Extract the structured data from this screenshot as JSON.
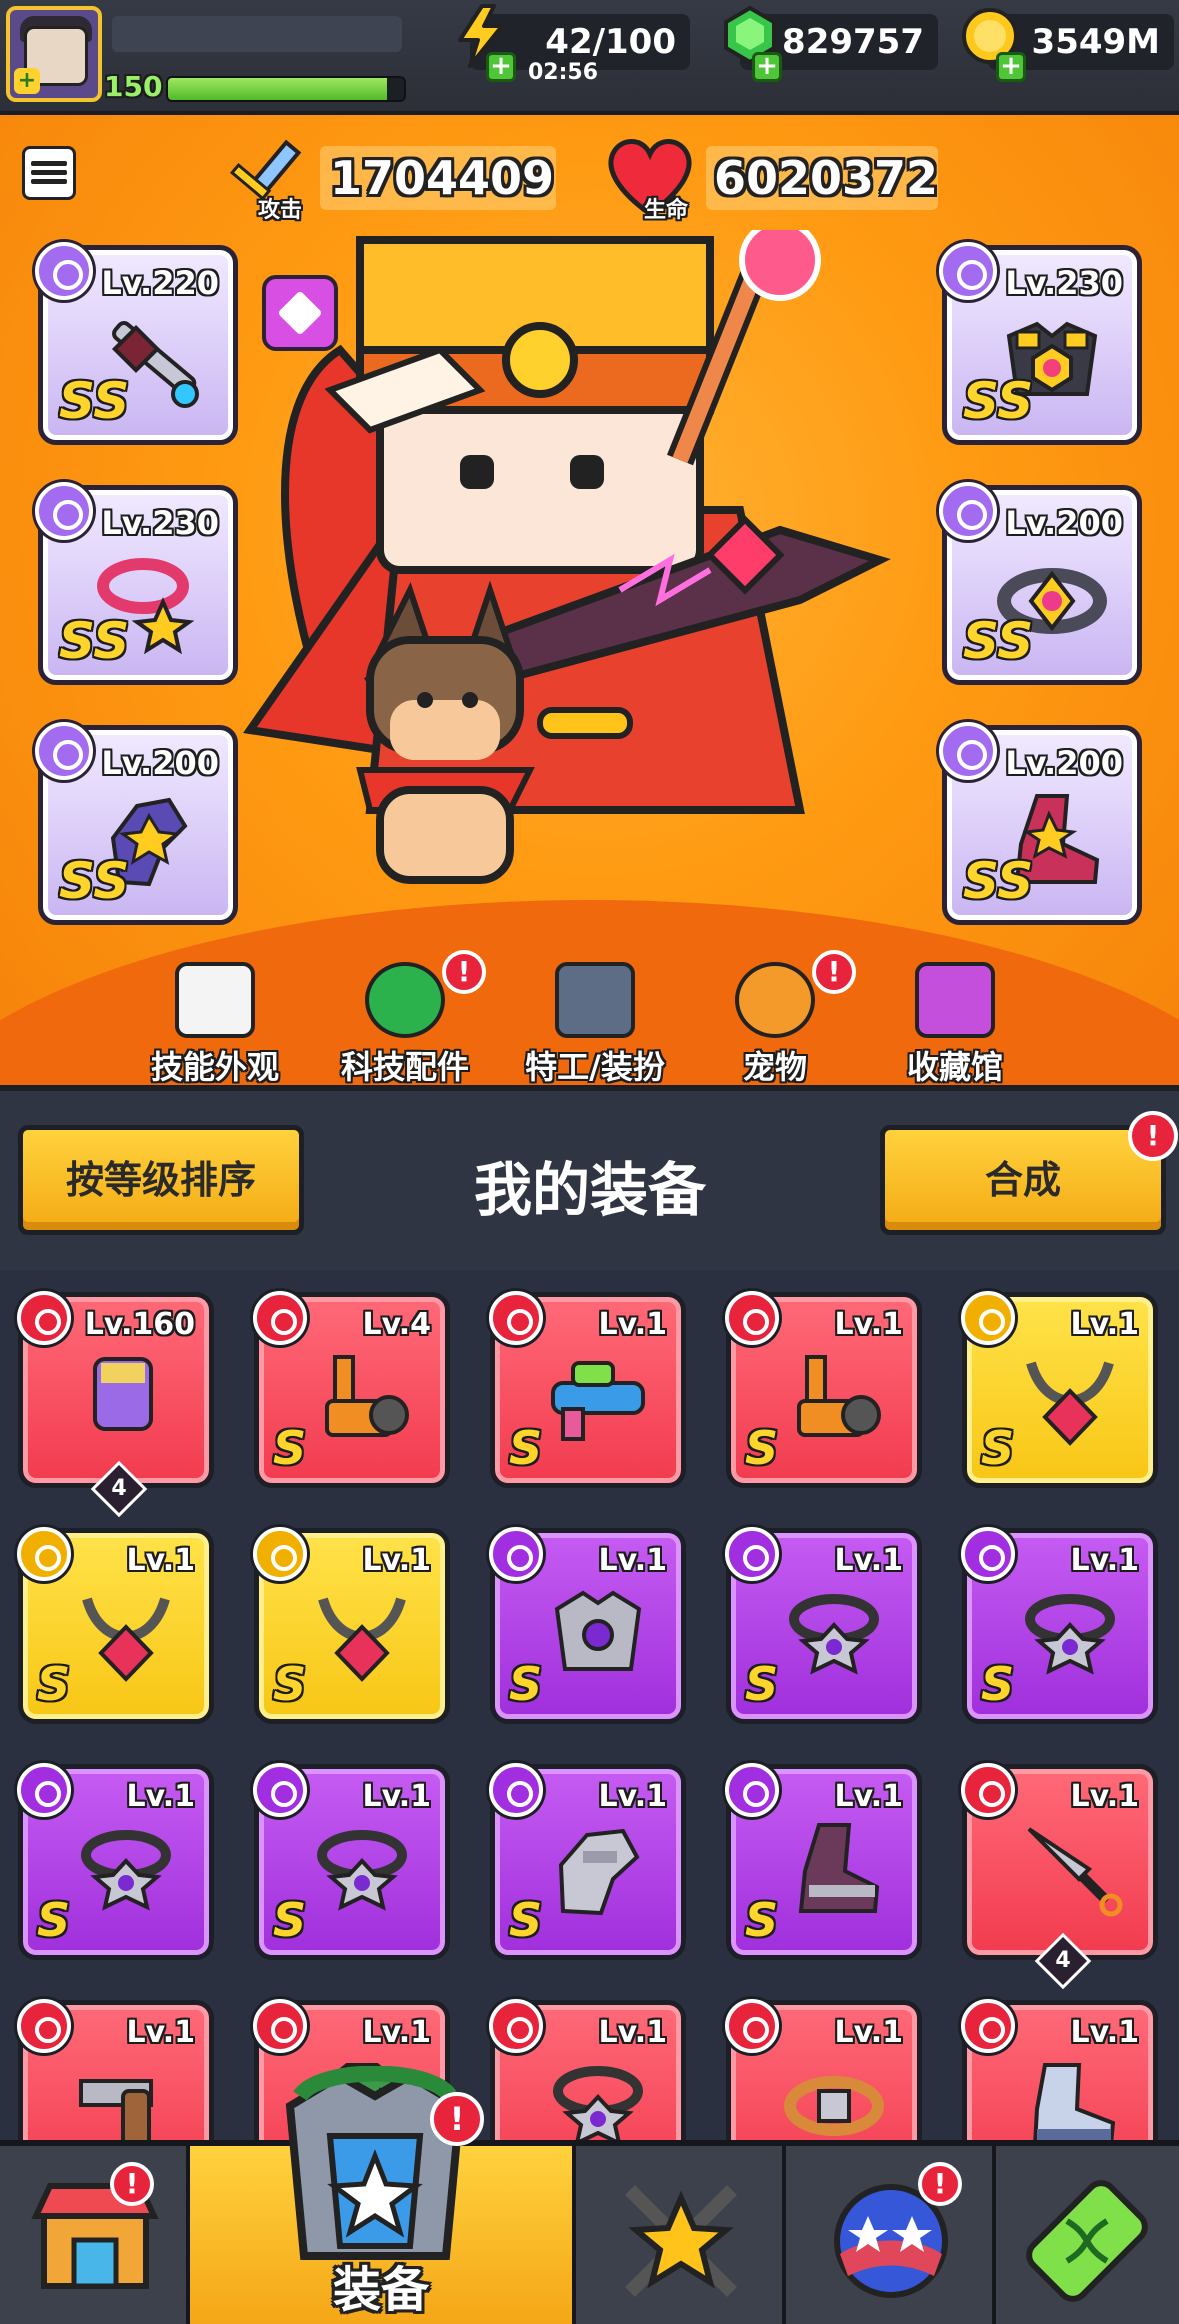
{
  "player": {
    "level": "150",
    "xp_fraction": 0.93
  },
  "resources": {
    "energy": "42/100",
    "energy_timer": "02:56",
    "gems": "829757",
    "coins": "3549M"
  },
  "stats": {
    "attack_label": "攻击",
    "attack_value": "1704409",
    "hp_label": "生命",
    "hp_value": "6020372"
  },
  "equipped": [
    {
      "slot": "weapon",
      "level": "Lv.220",
      "rank": "SS",
      "icon": "sword-staff-icon"
    },
    {
      "slot": "armor",
      "level": "Lv.230",
      "rank": "SS",
      "icon": "armor-icon"
    },
    {
      "slot": "necklace",
      "level": "Lv.230",
      "rank": "SS",
      "icon": "necklace-icon"
    },
    {
      "slot": "belt",
      "level": "Lv.200",
      "rank": "SS",
      "icon": "belt-icon"
    },
    {
      "slot": "gloves",
      "level": "Lv.200",
      "rank": "SS",
      "icon": "glove-icon"
    },
    {
      "slot": "boots",
      "level": "Lv.200",
      "rank": "SS",
      "icon": "boot-icon"
    }
  ],
  "sub_menu": [
    {
      "label": "技能外观",
      "icon": "soccer-ball-hat-icon",
      "alert": false
    },
    {
      "label": "科技配件",
      "icon": "hex-gear-icon",
      "alert": true
    },
    {
      "label": "特工/装扮",
      "icon": "agent-icon",
      "alert": false
    },
    {
      "label": "宠物",
      "icon": "shiba-pet-icon",
      "alert": true
    },
    {
      "label": "收藏馆",
      "icon": "collection-chest-icon",
      "alert": false
    }
  ],
  "equip_header": {
    "sort_label": "按等级排序",
    "title": "我的装备",
    "merge_label": "合成",
    "merge_alert": "!"
  },
  "inventory": [
    {
      "color": "red",
      "level": "Lv.160",
      "rank": "",
      "count": "4",
      "icon": "gauntlet-icon"
    },
    {
      "color": "red",
      "level": "Lv.4",
      "rank": "S",
      "count": "",
      "icon": "wheel-cannon-icon"
    },
    {
      "color": "red",
      "level": "Lv.1",
      "rank": "S",
      "count": "",
      "icon": "water-gun-icon"
    },
    {
      "color": "red",
      "level": "Lv.1",
      "rank": "S",
      "count": "",
      "icon": "wheel-cannon-icon"
    },
    {
      "color": "yellow",
      "level": "Lv.1",
      "rank": "S",
      "count": "",
      "icon": "chain-necklace-icon"
    },
    {
      "color": "yellow",
      "level": "Lv.1",
      "rank": "S",
      "count": "",
      "icon": "chain-necklace-icon"
    },
    {
      "color": "yellow",
      "level": "Lv.1",
      "rank": "S",
      "count": "",
      "icon": "chain-necklace-icon"
    },
    {
      "color": "purple",
      "level": "Lv.1",
      "rank": "S",
      "count": "",
      "icon": "spiked-armor-icon"
    },
    {
      "color": "purple",
      "level": "Lv.1",
      "rank": "S",
      "count": "",
      "icon": "spiked-collar-icon"
    },
    {
      "color": "purple",
      "level": "Lv.1",
      "rank": "S",
      "count": "",
      "icon": "spiked-collar-icon"
    },
    {
      "color": "purple",
      "level": "Lv.1",
      "rank": "S",
      "count": "",
      "icon": "spiked-collar-icon"
    },
    {
      "color": "purple",
      "level": "Lv.1",
      "rank": "S",
      "count": "",
      "icon": "spiked-collar-icon"
    },
    {
      "color": "purple",
      "level": "Lv.1",
      "rank": "S",
      "count": "",
      "icon": "armored-glove-icon"
    },
    {
      "color": "purple",
      "level": "Lv.1",
      "rank": "S",
      "count": "",
      "icon": "armored-boot-icon"
    },
    {
      "color": "red",
      "level": "Lv.1",
      "rank": "",
      "count": "4",
      "icon": "kunai-icon"
    },
    {
      "color": "red",
      "level": "Lv.1",
      "rank": "",
      "count": "",
      "icon": "revolver-icon"
    },
    {
      "color": "red",
      "level": "Lv.1",
      "rank": "",
      "count": "",
      "icon": "shirt-icon"
    },
    {
      "color": "red",
      "level": "Lv.1",
      "rank": "",
      "count": "",
      "icon": "spiked-collar-icon"
    },
    {
      "color": "red",
      "level": "Lv.1",
      "rank": "",
      "count": "",
      "icon": "belt-icon"
    },
    {
      "color": "red",
      "level": "Lv.1",
      "rank": "",
      "count": "",
      "icon": "sneaker-icon"
    }
  ],
  "bottom_nav": [
    {
      "label": "",
      "icon": "shop-icon",
      "alert": true
    },
    {
      "label": "装备",
      "icon": "armor-chest-icon",
      "alert": true,
      "active": true
    },
    {
      "label": "",
      "icon": "star-swords-icon",
      "alert": false
    },
    {
      "label": "",
      "icon": "planet-stars-icon",
      "alert": true
    },
    {
      "label": "",
      "icon": "dna-battery-icon",
      "alert": false
    }
  ],
  "colors": {
    "accent_orange": "#ff9a12",
    "rarity_red": "#f23b4f",
    "rarity_yellow": "#f8c615",
    "rarity_purple": "#9f2fdc",
    "alert_red": "#e8233c"
  }
}
